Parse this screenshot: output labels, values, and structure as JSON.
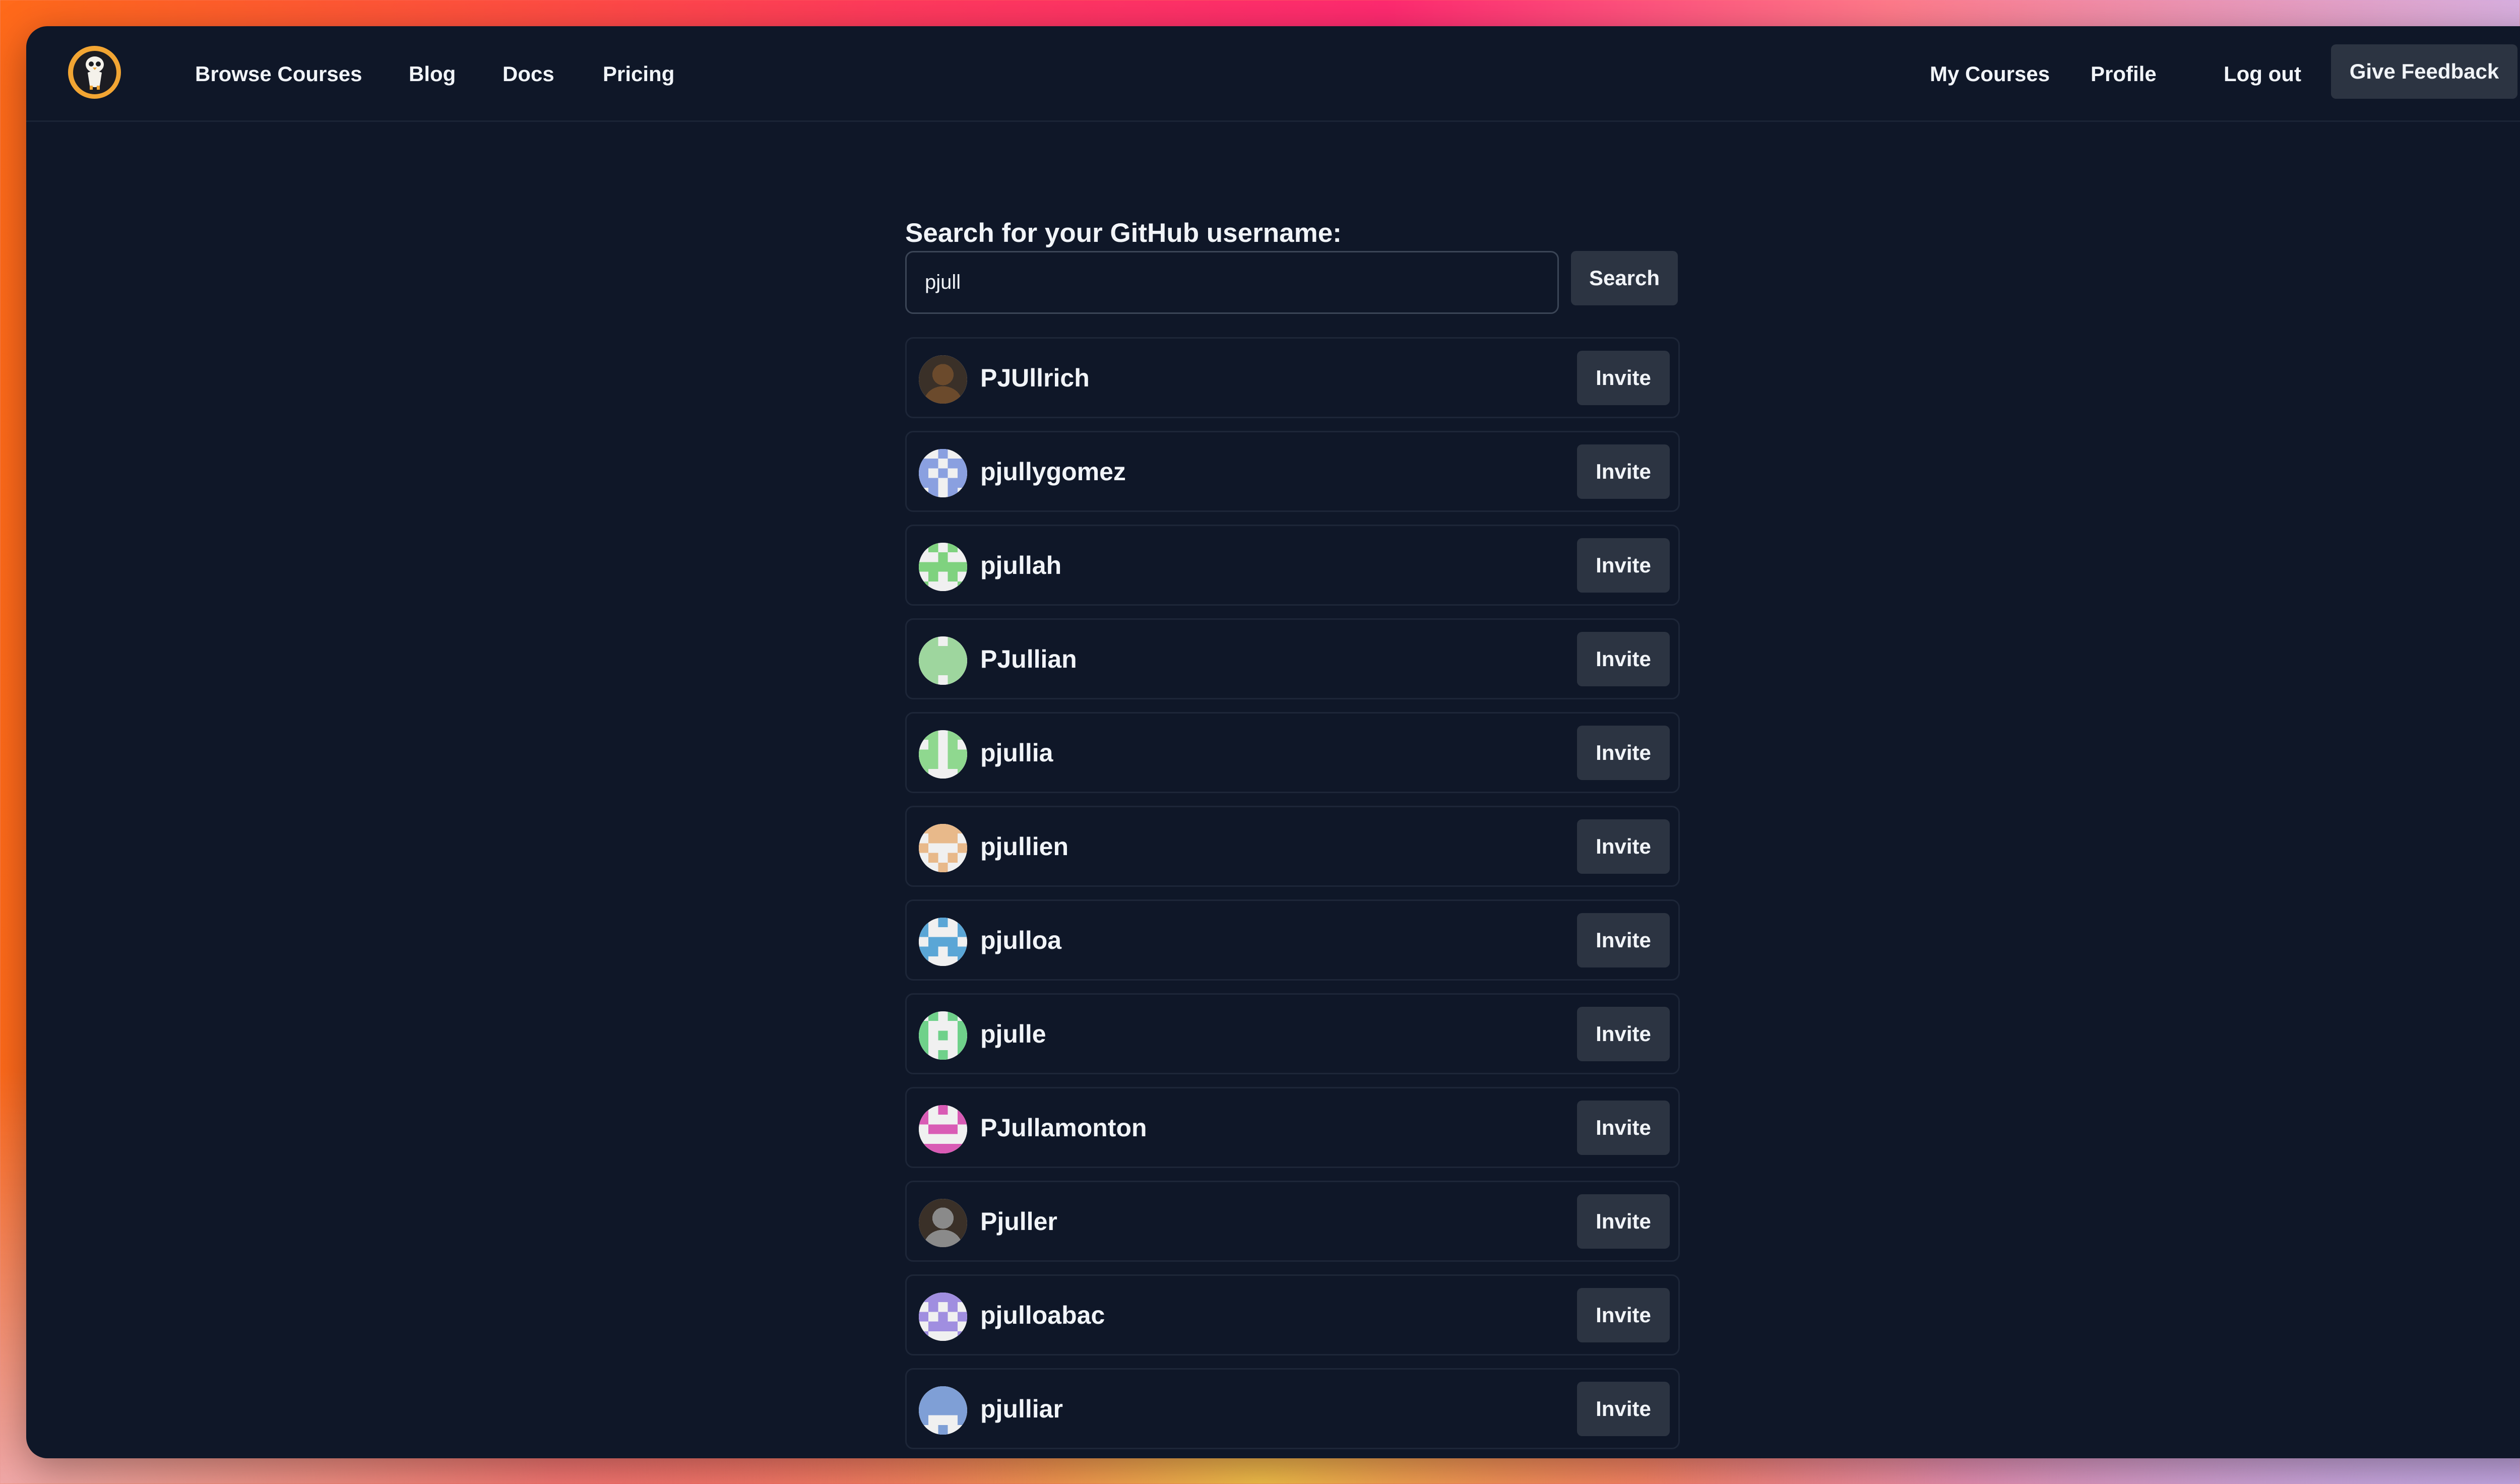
{
  "nav": {
    "left_links": [
      {
        "label": "Browse Courses",
        "name": "nav-browse-courses"
      },
      {
        "label": "Blog",
        "name": "nav-blog"
      },
      {
        "label": "Docs",
        "name": "nav-docs"
      },
      {
        "label": "Pricing",
        "name": "nav-pricing"
      }
    ],
    "right_links": [
      {
        "label": "My Courses",
        "name": "nav-my-courses"
      },
      {
        "label": "Profile",
        "name": "nav-profile"
      },
      {
        "label": "Log out",
        "name": "nav-log-out"
      }
    ],
    "feedback_label": "Give Feedback",
    "logo_icon": "owl-mascot-icon"
  },
  "search": {
    "label": "Search for your GitHub username:",
    "value": "pjull",
    "button_label": "Search"
  },
  "invite_label": "Invite",
  "results": [
    {
      "username": "PJUllrich",
      "avatar": "photo",
      "color": "#6b4a2c"
    },
    {
      "username": "pjullygomez",
      "avatar": "identicon",
      "color": "#8aa0e0"
    },
    {
      "username": "pjullah",
      "avatar": "identicon",
      "color": "#7fd27f"
    },
    {
      "username": "PJullian",
      "avatar": "identicon",
      "color": "#9ed69e"
    },
    {
      "username": "pjullia",
      "avatar": "identicon",
      "color": "#8fd88f"
    },
    {
      "username": "pjullien",
      "avatar": "identicon",
      "color": "#e8b98a"
    },
    {
      "username": "pjulloa",
      "avatar": "identicon",
      "color": "#5aa6d6"
    },
    {
      "username": "pjulle",
      "avatar": "identicon",
      "color": "#6fd18a"
    },
    {
      "username": "PJullamonton",
      "avatar": "identicon",
      "color": "#d95bb5"
    },
    {
      "username": "Pjuller",
      "avatar": "photo",
      "color": "#8a8a8a"
    },
    {
      "username": "pjulloabac",
      "avatar": "identicon",
      "color": "#a08ee0"
    },
    {
      "username": "pjulliar",
      "avatar": "identicon",
      "color": "#7f9fd6"
    }
  ]
}
